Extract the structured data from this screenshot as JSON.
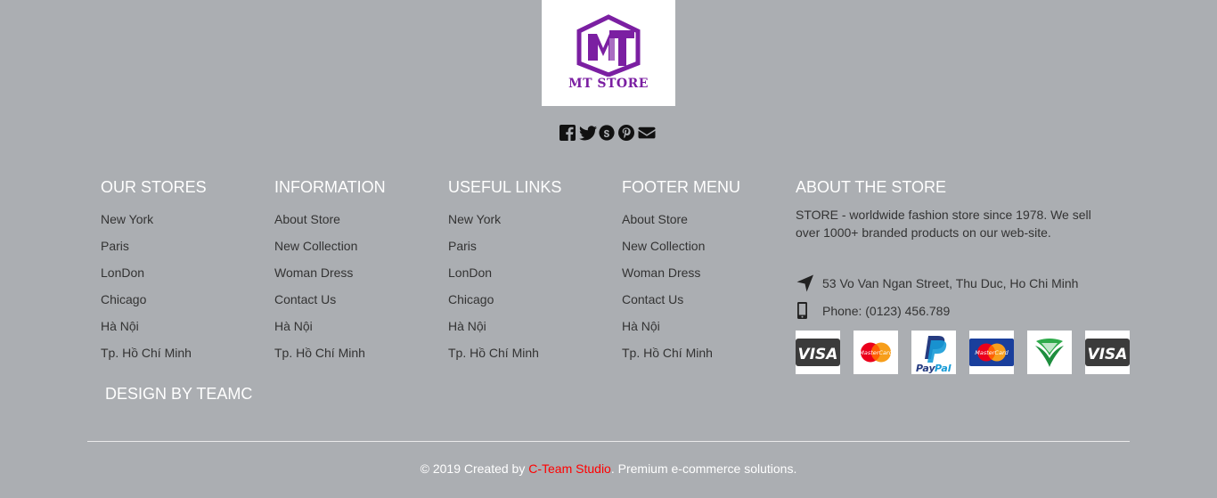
{
  "logo": {
    "text": "MT STORE",
    "mark": "MT"
  },
  "social": [
    "facebook-icon",
    "twitter-icon",
    "skype-icon",
    "pinterest-icon",
    "envelope-icon"
  ],
  "columns": [
    {
      "title": "OUR STORES",
      "items": [
        "New York",
        "Paris",
        "LonDon",
        "Chicago",
        "Hà Nội",
        "Tp. Hồ Chí Minh"
      ]
    },
    {
      "title": "INFORMATION",
      "items": [
        "About Store",
        "New Collection",
        "Woman Dress",
        "Contact Us",
        "Hà Nội",
        "Tp. Hồ Chí Minh"
      ]
    },
    {
      "title": "USEFUL LINKS",
      "items": [
        "New York",
        "Paris",
        "LonDon",
        "Chicago",
        "Hà Nội",
        "Tp. Hồ Chí Minh"
      ]
    },
    {
      "title": "FOOTER MENU",
      "items": [
        "About Store",
        "New Collection",
        "Woman Dress",
        "Contact Us",
        "Hà Nội",
        "Tp. Hồ Chí Minh"
      ]
    }
  ],
  "about": {
    "title": "ABOUT THE STORE",
    "description": "STORE - worldwide fashion store since 1978. We sell over 1000+ branded products on our web-site.",
    "address": "53 Vo Van Ngan Street, Thu Duc, Ho Chi Minh",
    "phone": "Phone: (0123) 456.789"
  },
  "payments": [
    "visa-icon",
    "mastercard-icon",
    "paypal-icon",
    "maestro-icon",
    "vietcombank-icon",
    "visa-icon"
  ],
  "payment_labels": {
    "visa": "VISA",
    "mastercard": "MasterCard",
    "paypal_pay": "Pay",
    "paypal_pal": "Pal",
    "maestro": "MasterCard"
  },
  "design_credit": "DESIGN BY TEAMC",
  "copyright": {
    "prefix": "© 2019 Created by ",
    "brand": "C-Team Studio",
    "suffix": ". Premium e-commerce solutions."
  },
  "colors": {
    "background": "#abaeb2",
    "heading": "#ffffff",
    "text": "#333333",
    "brand_red": "#ff0000",
    "logo_purple": "#7b1fa2"
  }
}
